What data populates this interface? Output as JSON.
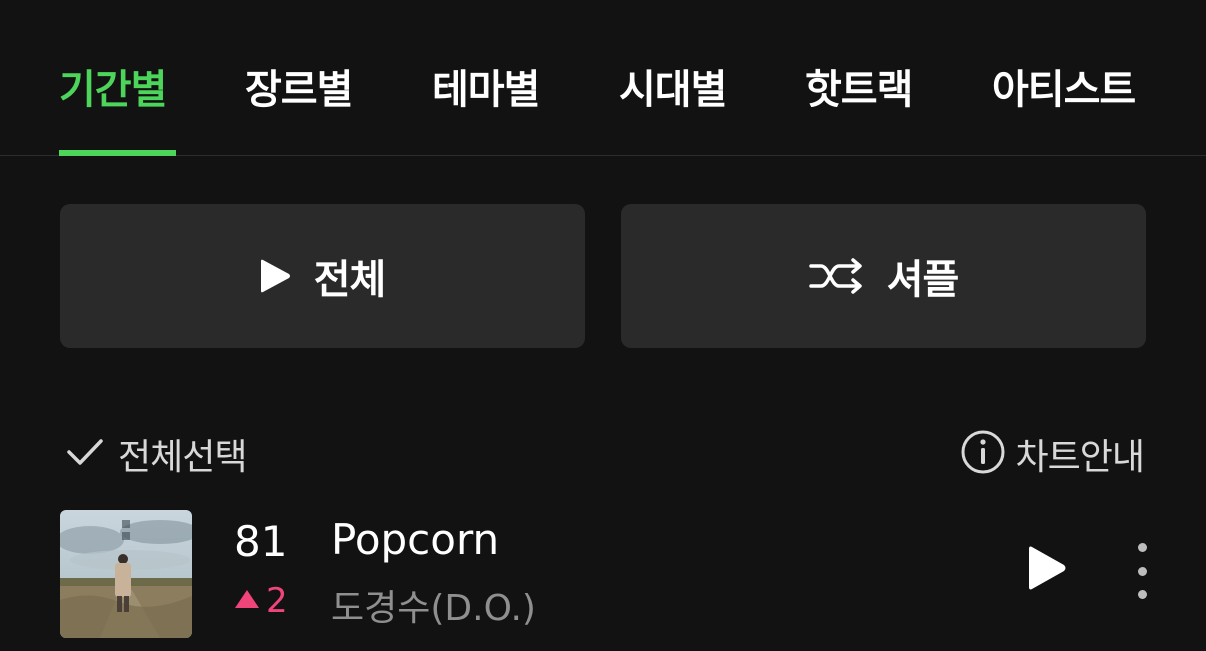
{
  "tabs": [
    {
      "label": "기간별",
      "active": true
    },
    {
      "label": "장르별",
      "active": false
    },
    {
      "label": "테마별",
      "active": false
    },
    {
      "label": "시대별",
      "active": false
    },
    {
      "label": "핫트랙",
      "active": false
    },
    {
      "label": "아티스트",
      "active": false
    }
  ],
  "actions": {
    "play_all_label": "전체",
    "play_all_icon": "play-icon",
    "shuffle_label": "셔플",
    "shuffle_icon": "shuffle-icon"
  },
  "toolbar": {
    "select_all_label": "전체선택",
    "chart_info_label": "차트안내"
  },
  "tracks": [
    {
      "rank": "81",
      "rank_change": "2",
      "rank_change_direction": "up",
      "title": "Popcorn",
      "artist": "도경수(D.O.)"
    }
  ],
  "colors": {
    "background": "#121212",
    "accent_green": "#4dd45a",
    "button_bg": "#2a2a2a",
    "rank_up": "#f0457a",
    "secondary_text": "#8f8f8f"
  }
}
